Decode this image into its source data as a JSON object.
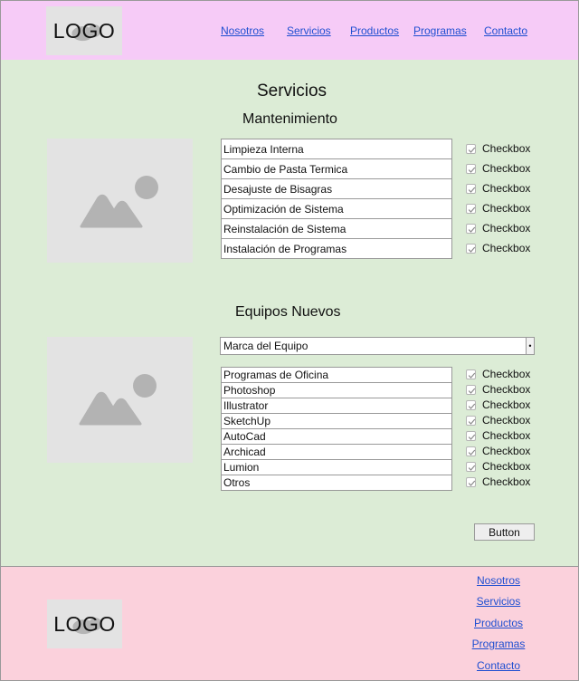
{
  "header": {
    "logo_text": "LOGO",
    "nav": [
      "Nosotros",
      "Servicios",
      "Productos",
      "Programas",
      "Contacto"
    ]
  },
  "main": {
    "title": "Servicios",
    "mantenimiento": {
      "title": "Mantenimiento",
      "items": [
        "Limpieza Interna",
        "Cambio de Pasta Termica",
        "Desajuste de Bisagras",
        "Optimización de Sistema",
        "Reinstalación de Sistema",
        "Instalación de Programas"
      ],
      "checkbox_label": "Checkbox"
    },
    "equipos": {
      "title": "Equipos Nuevos",
      "select_value": "Marca del Equipo",
      "items": [
        "Programas de Oficina",
        "Photoshop",
        "Illustrator",
        "SketchUp",
        "AutoCad",
        "Archicad",
        "Lumion",
        "Otros"
      ],
      "checkbox_label": "Checkbox"
    },
    "button_label": "Button"
  },
  "footer": {
    "logo_text": "LOGO",
    "nav": [
      "Nosotros",
      "Servicios",
      "Productos",
      "Programas",
      "Contacto"
    ]
  },
  "colors": {
    "header_bg": "#f6cbf7",
    "main_bg": "#dcecd6",
    "footer_bg": "#fbd1dc",
    "link": "#1f4fd1",
    "placeholder": "#e3e3e3",
    "placeholder_icon": "#b3b3b3"
  },
  "icons": {
    "image_placeholder": "image-placeholder-icon",
    "checkbox": "check-icon",
    "dropdown": "chevron-down-icon"
  }
}
